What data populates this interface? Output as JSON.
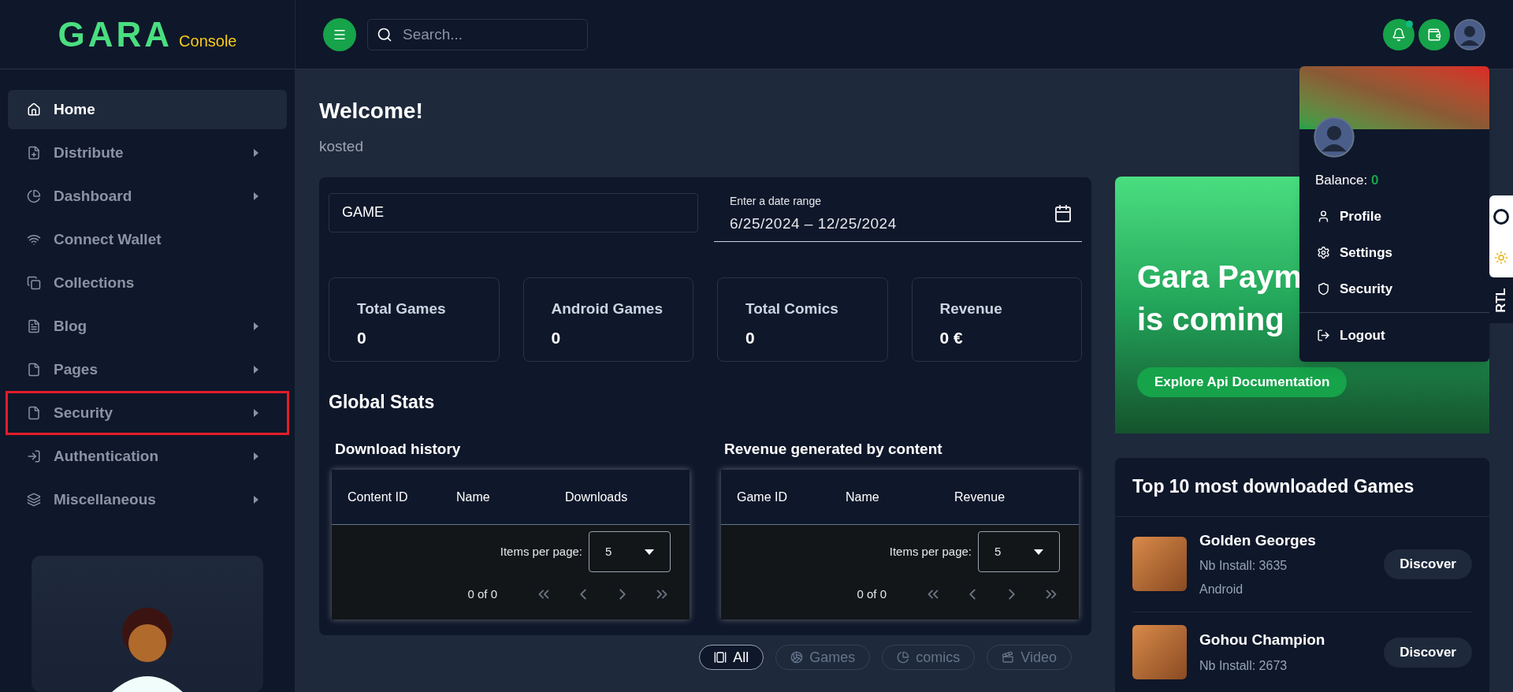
{
  "logo": {
    "text": "GARA",
    "suffix": "Console"
  },
  "search": {
    "placeholder": "Search..."
  },
  "header": {
    "notification_dot": true
  },
  "sidebar": {
    "items": [
      {
        "label": "Home",
        "selected": true,
        "has_submenu": false,
        "highlighted": false
      },
      {
        "label": "Distribute",
        "selected": false,
        "has_submenu": true,
        "highlighted": false
      },
      {
        "label": "Dashboard",
        "selected": false,
        "has_submenu": true,
        "highlighted": false
      },
      {
        "label": "Connect Wallet",
        "selected": false,
        "has_submenu": false,
        "highlighted": false
      },
      {
        "label": "Collections",
        "selected": false,
        "has_submenu": false,
        "highlighted": false
      },
      {
        "label": "Blog",
        "selected": false,
        "has_submenu": true,
        "highlighted": false
      },
      {
        "label": "Pages",
        "selected": false,
        "has_submenu": true,
        "highlighted": false
      },
      {
        "label": "Security",
        "selected": false,
        "has_submenu": true,
        "highlighted": true
      },
      {
        "label": "Authentication",
        "selected": false,
        "has_submenu": true,
        "highlighted": false
      },
      {
        "label": "Miscellaneous",
        "selected": false,
        "has_submenu": true,
        "highlighted": false
      }
    ]
  },
  "welcome": {
    "title": "Welcome!",
    "subtitle": "kosted"
  },
  "filters": {
    "category": "GAME",
    "date_range": {
      "label": "Enter a date range",
      "value": "6/25/2024 – 12/25/2024"
    }
  },
  "stats": [
    {
      "label": "Total Games",
      "value": "0"
    },
    {
      "label": "Android Games",
      "value": "0"
    },
    {
      "label": "Total Comics",
      "value": "0"
    },
    {
      "label": "Revenue",
      "value": "0 €"
    }
  ],
  "global_stats": {
    "title": "Global Stats"
  },
  "tables": [
    {
      "title": "Download history",
      "columns": [
        "Content ID",
        "Name",
        "Downloads"
      ],
      "items_per_page_label": "Items per page:",
      "items_per_page": "5",
      "range": "0 of 0"
    },
    {
      "title": "Revenue generated by content",
      "columns": [
        "Game ID",
        "Name",
        "Revenue"
      ],
      "items_per_page_label": "Items per page:",
      "items_per_page": "5",
      "range": "0 of 0"
    }
  ],
  "content_tabs": [
    {
      "label": "All",
      "selected": true
    },
    {
      "label": "Games",
      "selected": false
    },
    {
      "label": "comics",
      "selected": false
    },
    {
      "label": "Video",
      "selected": false
    }
  ],
  "promo": {
    "title_lines": [
      "Gara Paym",
      "is coming"
    ],
    "button": "Explore Api Documentation"
  },
  "top_games": {
    "title": "Top 10 most downloaded Games",
    "items": [
      {
        "name": "Golden Georges",
        "installs": "Nb Install: 3635",
        "platform": "Android",
        "button": "Discover"
      },
      {
        "name": "Gohou Champion",
        "installs": "Nb Install: 2673",
        "button": "Discover"
      }
    ]
  },
  "user_menu": {
    "balance_label": "Balance:",
    "balance": "0",
    "items": [
      {
        "label": "Profile"
      },
      {
        "label": "Settings"
      },
      {
        "label": "Security"
      }
    ],
    "logout": "Logout"
  },
  "rtl_tab": {
    "label": "RTL"
  }
}
